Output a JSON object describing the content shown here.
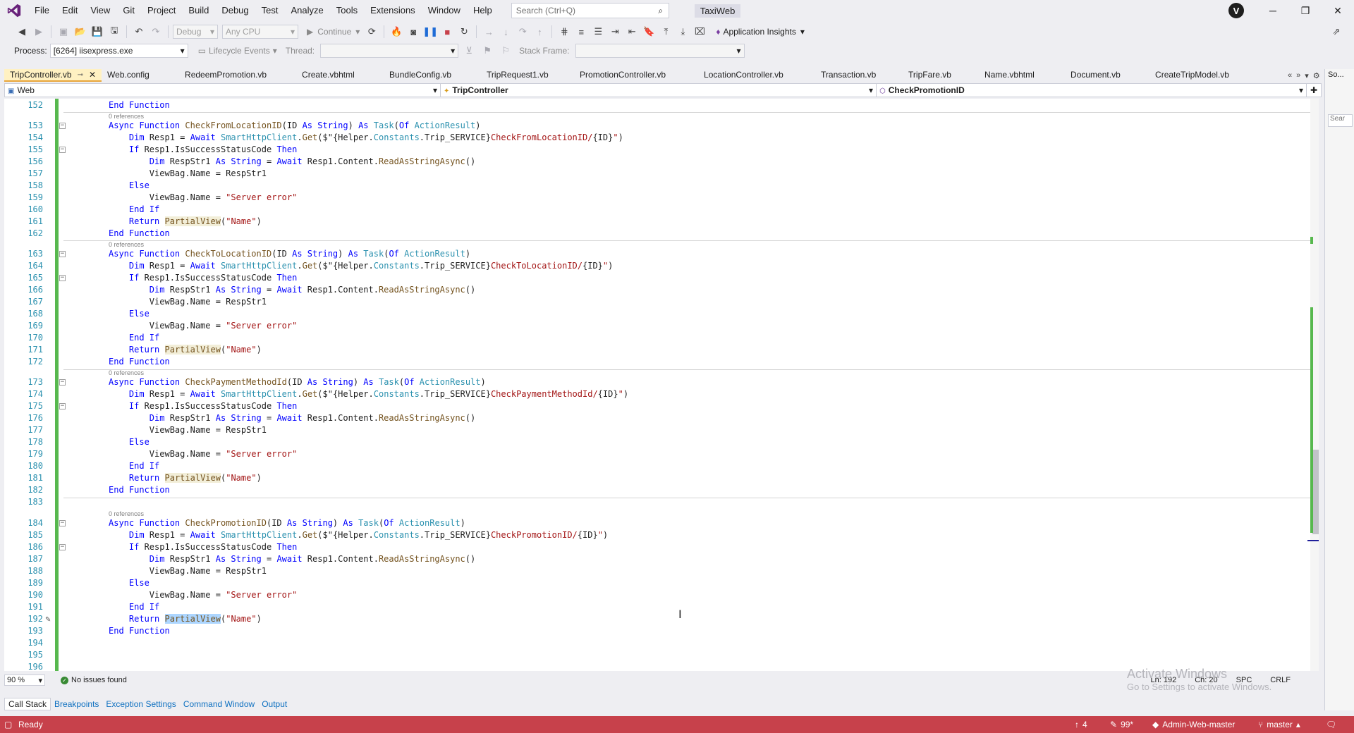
{
  "menu": {
    "items": [
      "File",
      "Edit",
      "View",
      "Git",
      "Project",
      "Build",
      "Debug",
      "Test",
      "Analyze",
      "Tools",
      "Extensions",
      "Window",
      "Help"
    ],
    "search_placeholder": "Search (Ctrl+Q)",
    "solution_name": "TaxiWeb",
    "avatar_initial": "V"
  },
  "toolbar": {
    "config": "Debug",
    "platform": "Any CPU",
    "continue_label": "Continue",
    "app_insights_label": "Application Insights"
  },
  "debug_bar": {
    "process_label": "Process:",
    "process_value": "[6264] iisexpress.exe",
    "lifecycle_label": "Lifecycle Events",
    "thread_label": "Thread:",
    "stack_frame_label": "Stack Frame:"
  },
  "tabs": [
    {
      "label": "TripController.vb",
      "active": true
    },
    {
      "label": "Web.config",
      "active": false
    },
    {
      "label": "RedeemPromotion.vb",
      "active": false
    },
    {
      "label": "Create.vbhtml",
      "active": false
    },
    {
      "label": "BundleConfig.vb",
      "active": false
    },
    {
      "label": "TripRequest1.vb",
      "active": false
    },
    {
      "label": "PromotionController.vb",
      "active": false
    },
    {
      "label": "LocationController.vb",
      "active": false
    },
    {
      "label": "Transaction.vb",
      "active": false
    },
    {
      "label": "TripFare.vb",
      "active": false
    },
    {
      "label": "Name.vbhtml",
      "active": false
    },
    {
      "label": "Document.vb",
      "active": false
    },
    {
      "label": "CreateTripModel.vb",
      "active": false
    }
  ],
  "navbar": {
    "project": "Web",
    "type": "TripController",
    "member": "CheckPromotionID"
  },
  "right_panel": {
    "title": "So...",
    "search_placeholder": "Sear"
  },
  "editor": {
    "refs_label": "0 references",
    "line_numbers": [
      "152",
      "153",
      "154",
      "155",
      "156",
      "157",
      "158",
      "159",
      "160",
      "161",
      "162",
      "163",
      "164",
      "165",
      "166",
      "167",
      "168",
      "169",
      "170",
      "171",
      "172",
      "173",
      "174",
      "175",
      "176",
      "177",
      "178",
      "179",
      "180",
      "181",
      "182",
      "183",
      "184",
      "185",
      "186",
      "187",
      "188",
      "189",
      "190",
      "191",
      "192",
      "193",
      "194",
      "195",
      "196"
    ],
    "functions": [
      {
        "name": "CheckFromLocationID",
        "route": "CheckFromLocationID/"
      },
      {
        "name": "CheckToLocationID",
        "route": "CheckToLocationID/"
      },
      {
        "name": "CheckPaymentMethodId",
        "route": "CheckPaymentMethodId/"
      },
      {
        "name": "CheckPromotionID",
        "route": "CheckPromotionID/"
      }
    ]
  },
  "editor_status": {
    "zoom": "90 %",
    "issues": "No issues found",
    "line": "Ln: 192",
    "char": "Ch: 20",
    "spc": "SPC",
    "eol": "CRLF"
  },
  "watermark": {
    "title": "Activate Windows",
    "subtitle": "Go to Settings to activate Windows."
  },
  "bottom_tabs": [
    "Call Stack",
    "Breakpoints",
    "Exception Settings",
    "Command Window",
    "Output"
  ],
  "statusbar": {
    "ready": "Ready",
    "up_count": "4",
    "pencil_count": "99*",
    "repo": "Admin-Web-master",
    "branch": "master",
    "bg_color": "#c7414b"
  }
}
